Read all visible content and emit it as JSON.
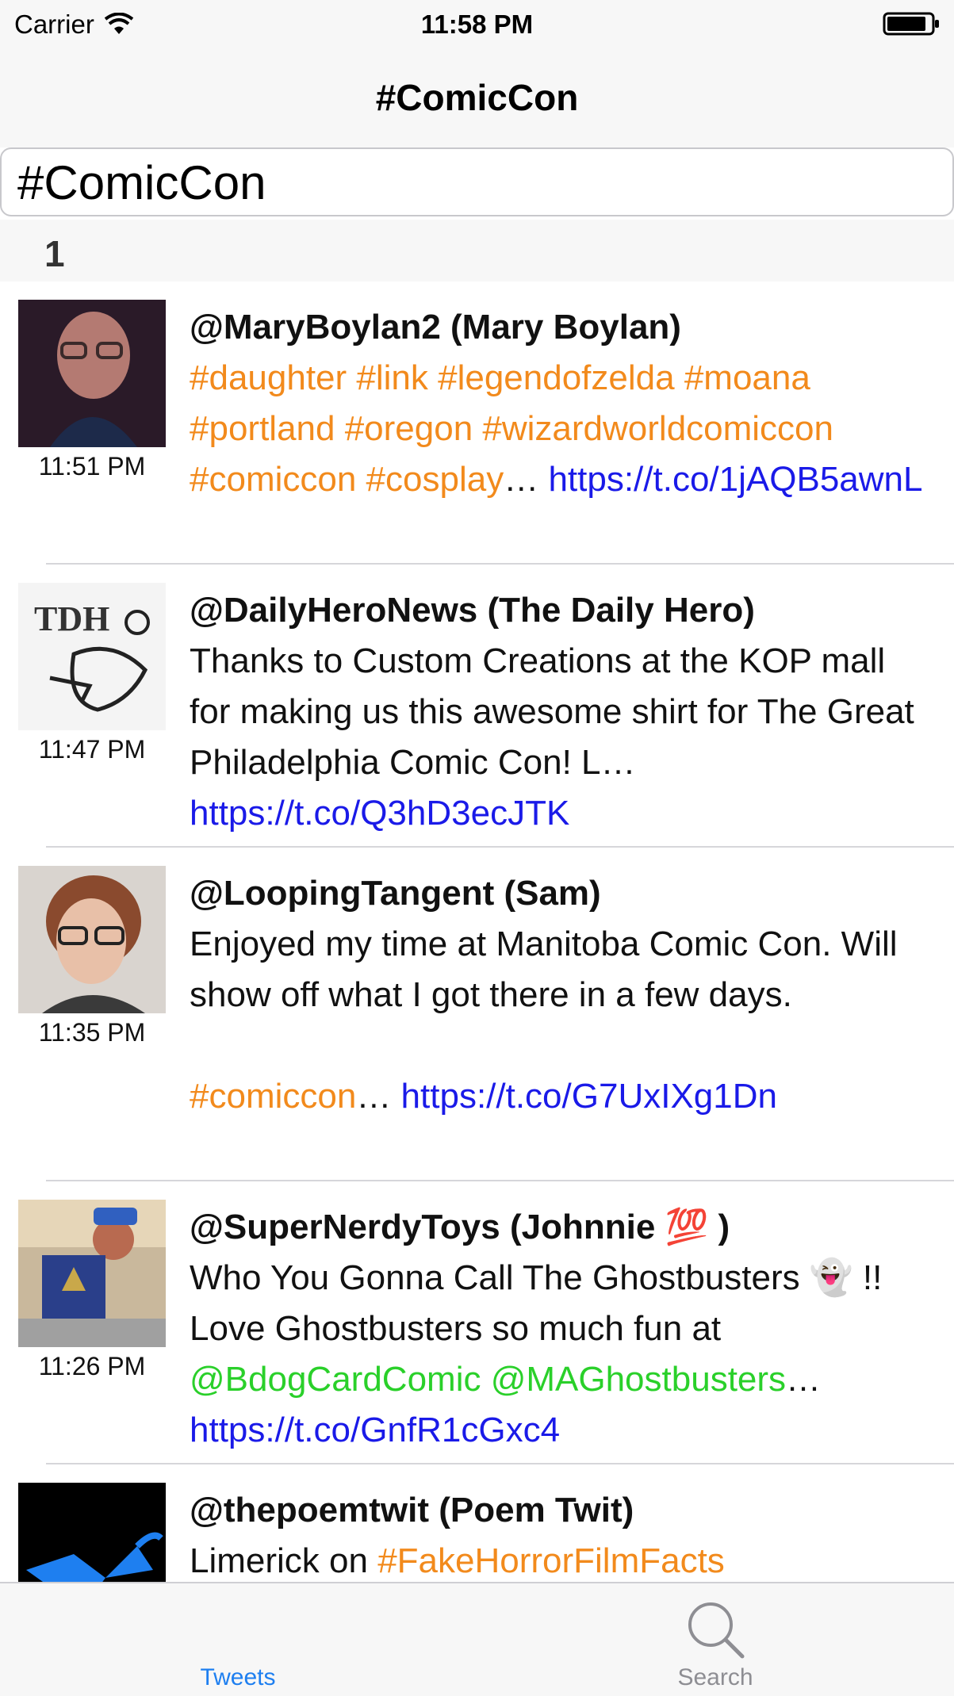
{
  "status": {
    "carrier": "Carrier",
    "time": "11:58 PM"
  },
  "nav": {
    "title": "#ComicCon"
  },
  "search": {
    "value": "#ComicCon"
  },
  "section": {
    "label": "1"
  },
  "tweets": [
    {
      "time": "11:51 PM",
      "handle": "@MaryBoylan2 (Mary Boylan)",
      "t1": "#daughter #link #legendofzelda #moana #portland #oregon #wizardworldcomiccon #comiccon #cosplay",
      "t2": "… ",
      "t3": "https://t.co/1jAQB5awnL"
    },
    {
      "time": "11:47 PM",
      "handle": "@DailyHeroNews (The Daily Hero)",
      "t1": "Thanks to Custom Creations at the KOP mall for making us this awesome shirt for The Great Philadelphia Comic Con! L… ",
      "t2": "https://t.co/Q3hD3ecJTK"
    },
    {
      "time": "11:35 PM",
      "handle": "@LoopingTangent (Sam)",
      "t1": "Enjoyed my time at Manitoba Comic Con. Will show off what I got there in a few days.",
      "t2": "#comiccon",
      "t3": "… ",
      "t4": "https://t.co/G7UxIXg1Dn"
    },
    {
      "time": "11:26 PM",
      "handle": "@SuperNerdyToys (Johnnie 💯 )",
      "t1": "Who You Gonna Call The Ghostbusters 👻 !! Love Ghostbusters so much fun at ",
      "t2": "@BdogCardComic @MAGhostbusters",
      "t3": "… ",
      "t4": "https://t.co/GnfR1cGxc4"
    },
    {
      "handle": "@thepoemtwit (Poem Twit)",
      "t1": "Limerick on ",
      "t2": "#FakeHorrorFilmFacts"
    }
  ],
  "tabs": {
    "tweets": "Tweets",
    "search": "Search"
  },
  "colors": {
    "hashtag": "#f28a1c",
    "url": "#1a1ae8",
    "mention": "#2ad02a",
    "tab_active": "#1e7ff0",
    "tab_inactive": "#8e8e93"
  },
  "icons": [
    "wifi-icon",
    "battery-icon",
    "search-icon"
  ]
}
